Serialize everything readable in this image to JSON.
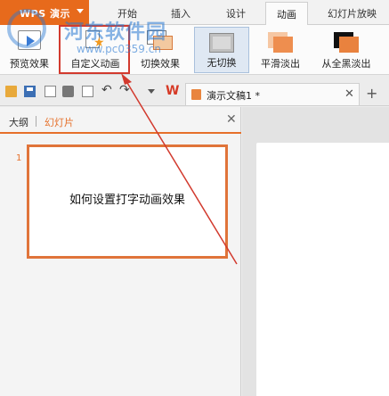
{
  "app": {
    "name": "WPS 演示"
  },
  "tabs": [
    "开始",
    "插入",
    "设计",
    "动画",
    "幻灯片放映"
  ],
  "active_tab": "动画",
  "ribbon": {
    "preview": "预览效果",
    "custom_animation": "自定义动画",
    "switch_effect": "切换效果",
    "transitions": [
      "无切换",
      "平滑淡出",
      "从全黑淡出"
    ]
  },
  "document": {
    "tab_title": "演示文稿1 *"
  },
  "left_pane": {
    "tab_outline": "大纲",
    "tab_slides": "幻灯片",
    "slide_number": "1",
    "slide_text": "如何设置打字动画效果"
  },
  "watermark": {
    "site": "河东软件园",
    "url": "www.pc0359.cn"
  },
  "colors": {
    "accent": "#e6702a",
    "highlight": "#d23a2e"
  }
}
